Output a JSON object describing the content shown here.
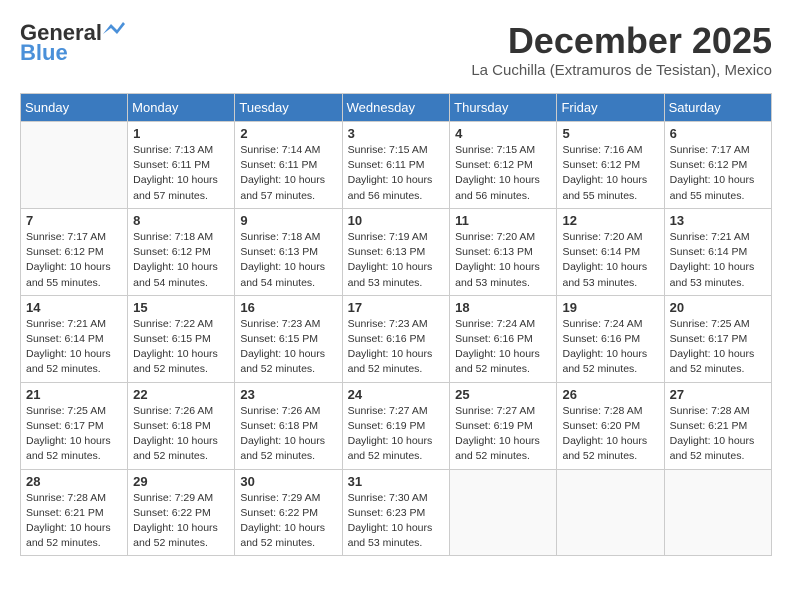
{
  "header": {
    "logo_general": "General",
    "logo_blue": "Blue",
    "month_title": "December 2025",
    "subtitle": "La Cuchilla (Extramuros de Tesistan), Mexico"
  },
  "calendar": {
    "columns": [
      "Sunday",
      "Monday",
      "Tuesday",
      "Wednesday",
      "Thursday",
      "Friday",
      "Saturday"
    ],
    "weeks": [
      [
        {
          "day": "",
          "info": ""
        },
        {
          "day": "1",
          "info": "Sunrise: 7:13 AM\nSunset: 6:11 PM\nDaylight: 10 hours\nand 57 minutes."
        },
        {
          "day": "2",
          "info": "Sunrise: 7:14 AM\nSunset: 6:11 PM\nDaylight: 10 hours\nand 57 minutes."
        },
        {
          "day": "3",
          "info": "Sunrise: 7:15 AM\nSunset: 6:11 PM\nDaylight: 10 hours\nand 56 minutes."
        },
        {
          "day": "4",
          "info": "Sunrise: 7:15 AM\nSunset: 6:12 PM\nDaylight: 10 hours\nand 56 minutes."
        },
        {
          "day": "5",
          "info": "Sunrise: 7:16 AM\nSunset: 6:12 PM\nDaylight: 10 hours\nand 55 minutes."
        },
        {
          "day": "6",
          "info": "Sunrise: 7:17 AM\nSunset: 6:12 PM\nDaylight: 10 hours\nand 55 minutes."
        }
      ],
      [
        {
          "day": "7",
          "info": "Sunrise: 7:17 AM\nSunset: 6:12 PM\nDaylight: 10 hours\nand 55 minutes."
        },
        {
          "day": "8",
          "info": "Sunrise: 7:18 AM\nSunset: 6:12 PM\nDaylight: 10 hours\nand 54 minutes."
        },
        {
          "day": "9",
          "info": "Sunrise: 7:18 AM\nSunset: 6:13 PM\nDaylight: 10 hours\nand 54 minutes."
        },
        {
          "day": "10",
          "info": "Sunrise: 7:19 AM\nSunset: 6:13 PM\nDaylight: 10 hours\nand 53 minutes."
        },
        {
          "day": "11",
          "info": "Sunrise: 7:20 AM\nSunset: 6:13 PM\nDaylight: 10 hours\nand 53 minutes."
        },
        {
          "day": "12",
          "info": "Sunrise: 7:20 AM\nSunset: 6:14 PM\nDaylight: 10 hours\nand 53 minutes."
        },
        {
          "day": "13",
          "info": "Sunrise: 7:21 AM\nSunset: 6:14 PM\nDaylight: 10 hours\nand 53 minutes."
        }
      ],
      [
        {
          "day": "14",
          "info": "Sunrise: 7:21 AM\nSunset: 6:14 PM\nDaylight: 10 hours\nand 52 minutes."
        },
        {
          "day": "15",
          "info": "Sunrise: 7:22 AM\nSunset: 6:15 PM\nDaylight: 10 hours\nand 52 minutes."
        },
        {
          "day": "16",
          "info": "Sunrise: 7:23 AM\nSunset: 6:15 PM\nDaylight: 10 hours\nand 52 minutes."
        },
        {
          "day": "17",
          "info": "Sunrise: 7:23 AM\nSunset: 6:16 PM\nDaylight: 10 hours\nand 52 minutes."
        },
        {
          "day": "18",
          "info": "Sunrise: 7:24 AM\nSunset: 6:16 PM\nDaylight: 10 hours\nand 52 minutes."
        },
        {
          "day": "19",
          "info": "Sunrise: 7:24 AM\nSunset: 6:16 PM\nDaylight: 10 hours\nand 52 minutes."
        },
        {
          "day": "20",
          "info": "Sunrise: 7:25 AM\nSunset: 6:17 PM\nDaylight: 10 hours\nand 52 minutes."
        }
      ],
      [
        {
          "day": "21",
          "info": "Sunrise: 7:25 AM\nSunset: 6:17 PM\nDaylight: 10 hours\nand 52 minutes."
        },
        {
          "day": "22",
          "info": "Sunrise: 7:26 AM\nSunset: 6:18 PM\nDaylight: 10 hours\nand 52 minutes."
        },
        {
          "day": "23",
          "info": "Sunrise: 7:26 AM\nSunset: 6:18 PM\nDaylight: 10 hours\nand 52 minutes."
        },
        {
          "day": "24",
          "info": "Sunrise: 7:27 AM\nSunset: 6:19 PM\nDaylight: 10 hours\nand 52 minutes."
        },
        {
          "day": "25",
          "info": "Sunrise: 7:27 AM\nSunset: 6:19 PM\nDaylight: 10 hours\nand 52 minutes."
        },
        {
          "day": "26",
          "info": "Sunrise: 7:28 AM\nSunset: 6:20 PM\nDaylight: 10 hours\nand 52 minutes."
        },
        {
          "day": "27",
          "info": "Sunrise: 7:28 AM\nSunset: 6:21 PM\nDaylight: 10 hours\nand 52 minutes."
        }
      ],
      [
        {
          "day": "28",
          "info": "Sunrise: 7:28 AM\nSunset: 6:21 PM\nDaylight: 10 hours\nand 52 minutes."
        },
        {
          "day": "29",
          "info": "Sunrise: 7:29 AM\nSunset: 6:22 PM\nDaylight: 10 hours\nand 52 minutes."
        },
        {
          "day": "30",
          "info": "Sunrise: 7:29 AM\nSunset: 6:22 PM\nDaylight: 10 hours\nand 52 minutes."
        },
        {
          "day": "31",
          "info": "Sunrise: 7:30 AM\nSunset: 6:23 PM\nDaylight: 10 hours\nand 53 minutes."
        },
        {
          "day": "",
          "info": ""
        },
        {
          "day": "",
          "info": ""
        },
        {
          "day": "",
          "info": ""
        }
      ]
    ]
  }
}
